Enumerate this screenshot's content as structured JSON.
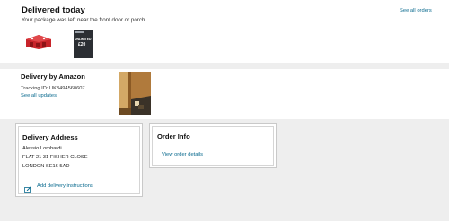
{
  "delivered": {
    "title": "Delivered today",
    "subtitle": "Your package was left near the front door or porch.",
    "see_all": "See all orders",
    "items": [
      {
        "icon": "red-lego-box-thumb"
      },
      {
        "icon": "dark-card-thumb",
        "text_line1": "UNLIMITED",
        "text_line2": "£20"
      }
    ]
  },
  "delivery_by": {
    "title": "Delivery by Amazon",
    "tracking": "Tracking ID: UK3494560607",
    "see_updates": "See all updates",
    "photo": "doorstep-photo"
  },
  "address": {
    "heading": "Delivery Address",
    "lines": [
      "Alessio Lombardi",
      "FLAT 21 31 FISHER CLOSE",
      "LONDON SE16 5AD"
    ],
    "instructions": "Add delivery instructions",
    "instructions_icon": "edit-square-icon"
  },
  "order_info": {
    "heading": "Order Info",
    "view": "View order details"
  },
  "colors": {
    "link": "#0b6b8f",
    "band": "#eeeeee",
    "border": "#c9c9c9"
  }
}
